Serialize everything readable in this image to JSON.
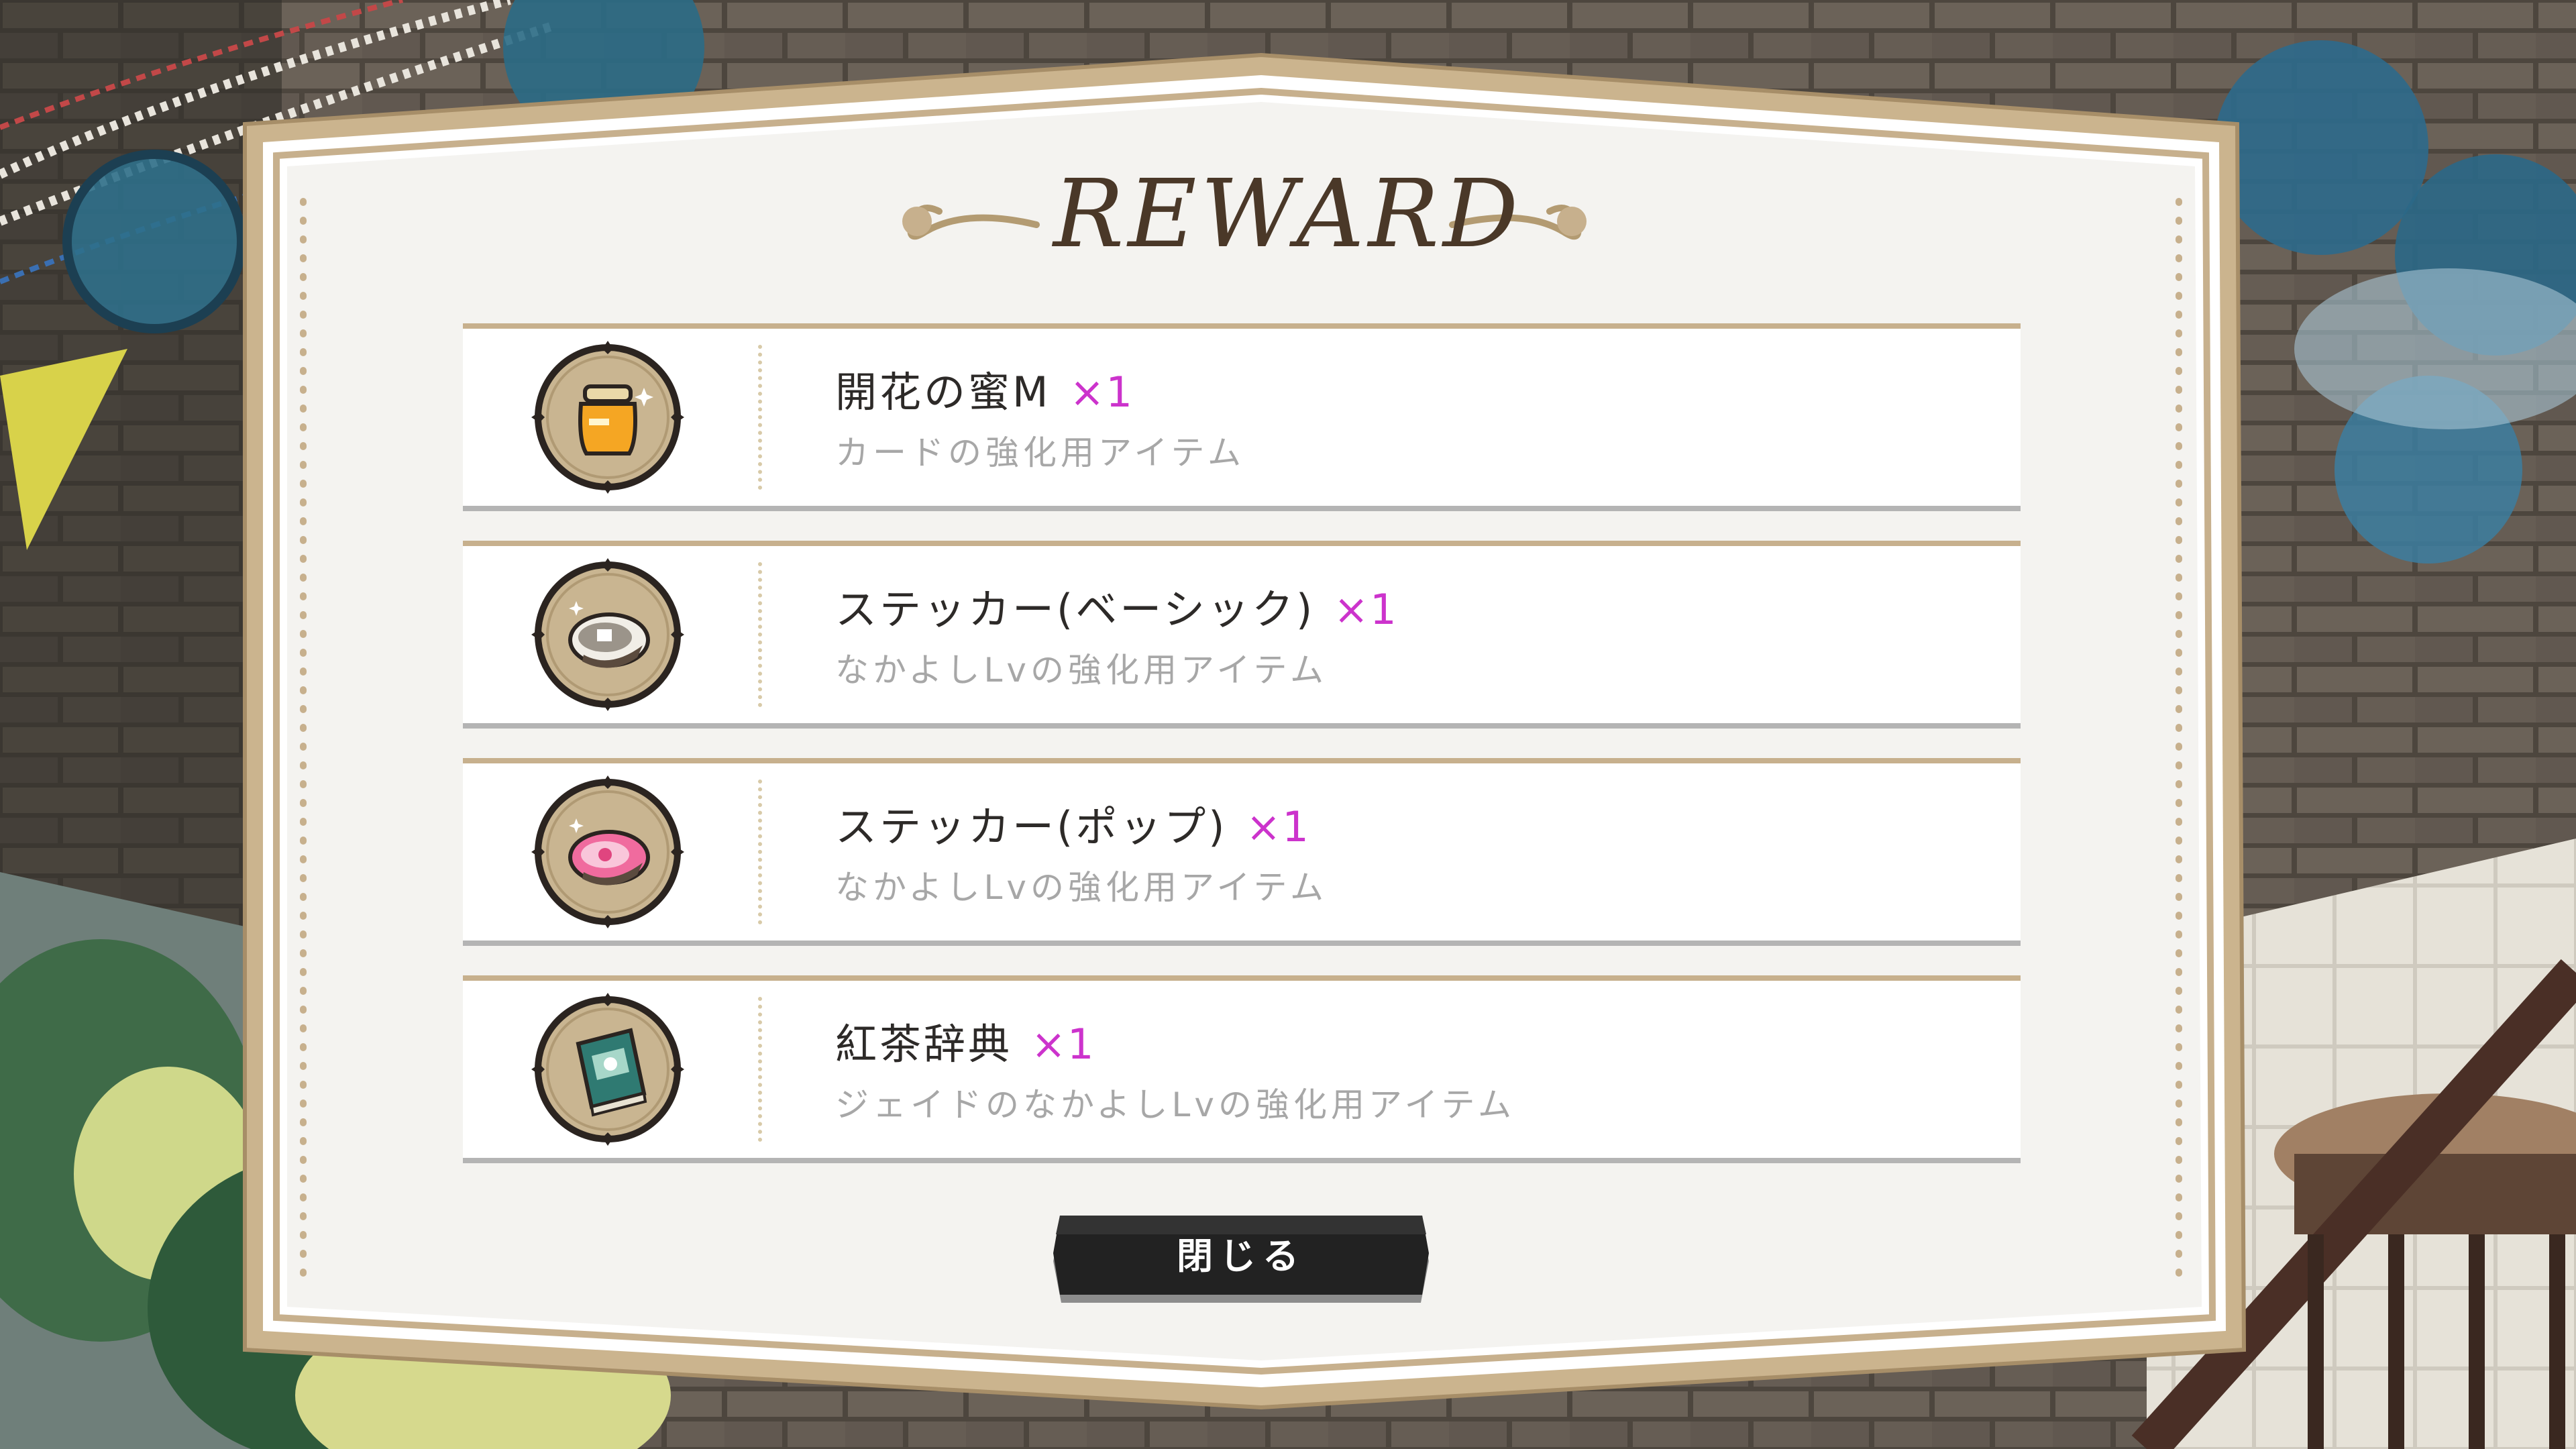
{
  "dialog": {
    "title": "REWARD",
    "close_label": "閉じる"
  },
  "rewards": [
    {
      "name": "開花の蜜M",
      "quantity": "×1",
      "description": "カードの強化用アイテム",
      "icon": "honey-jar-icon"
    },
    {
      "name": "ステッカー(ベーシック)",
      "quantity": "×1",
      "description": "なかよしLvの強化用アイテム",
      "icon": "sticker-basic-icon"
    },
    {
      "name": "ステッカー(ポップ)",
      "quantity": "×1",
      "description": "なかよしLvの強化用アイテム",
      "icon": "sticker-pop-icon"
    },
    {
      "name": "紅茶辞典",
      "quantity": "×1",
      "description": "ジェイドのなかよしLvの強化用アイテム",
      "icon": "tea-dictionary-icon"
    }
  ],
  "colors": {
    "quantity": "#cc33cc",
    "frame_gold": "#c7b08d",
    "panel": "#f4f3f0",
    "description": "#a7a7a7"
  }
}
